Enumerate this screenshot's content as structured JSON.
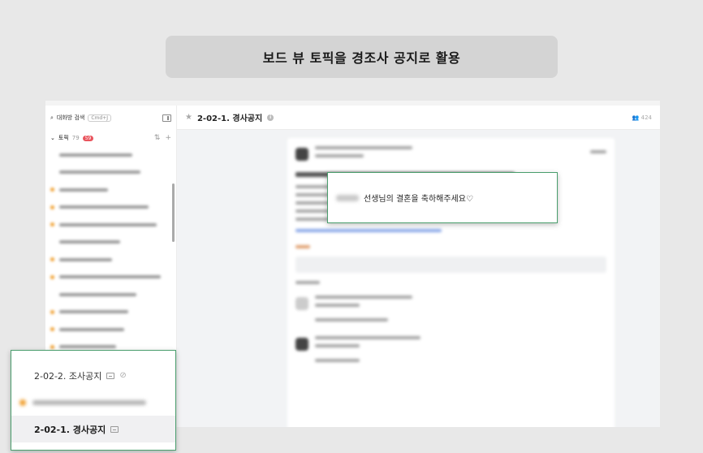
{
  "banner": {
    "title": "보드 뷰 토픽을 경조사 공지로 활용"
  },
  "sidebar": {
    "search_label": "대화방 검색",
    "search_shortcut": "Cmd+J",
    "topic_label": "토픽",
    "topic_count": "79",
    "topic_unread": "59"
  },
  "main": {
    "title": "2-02-1. 경사공지",
    "member_count": "424"
  },
  "callout_main": {
    "text": "선생님의 결혼을 축하해주세요♡"
  },
  "callout_side": {
    "item_1": "2-02-2. 조사공지",
    "item_2": "2-02-1. 경사공지"
  },
  "icons": {
    "search": "search-icon",
    "panel": "panel-toggle-icon",
    "star": "star-icon",
    "info": "info-icon",
    "members": "members-icon",
    "message": "message-icon",
    "mute": "mute-icon"
  },
  "colors": {
    "accent_green": "#4a9e6d",
    "unread_badge": "#e9545d",
    "topic_dot": "#f0a030"
  }
}
